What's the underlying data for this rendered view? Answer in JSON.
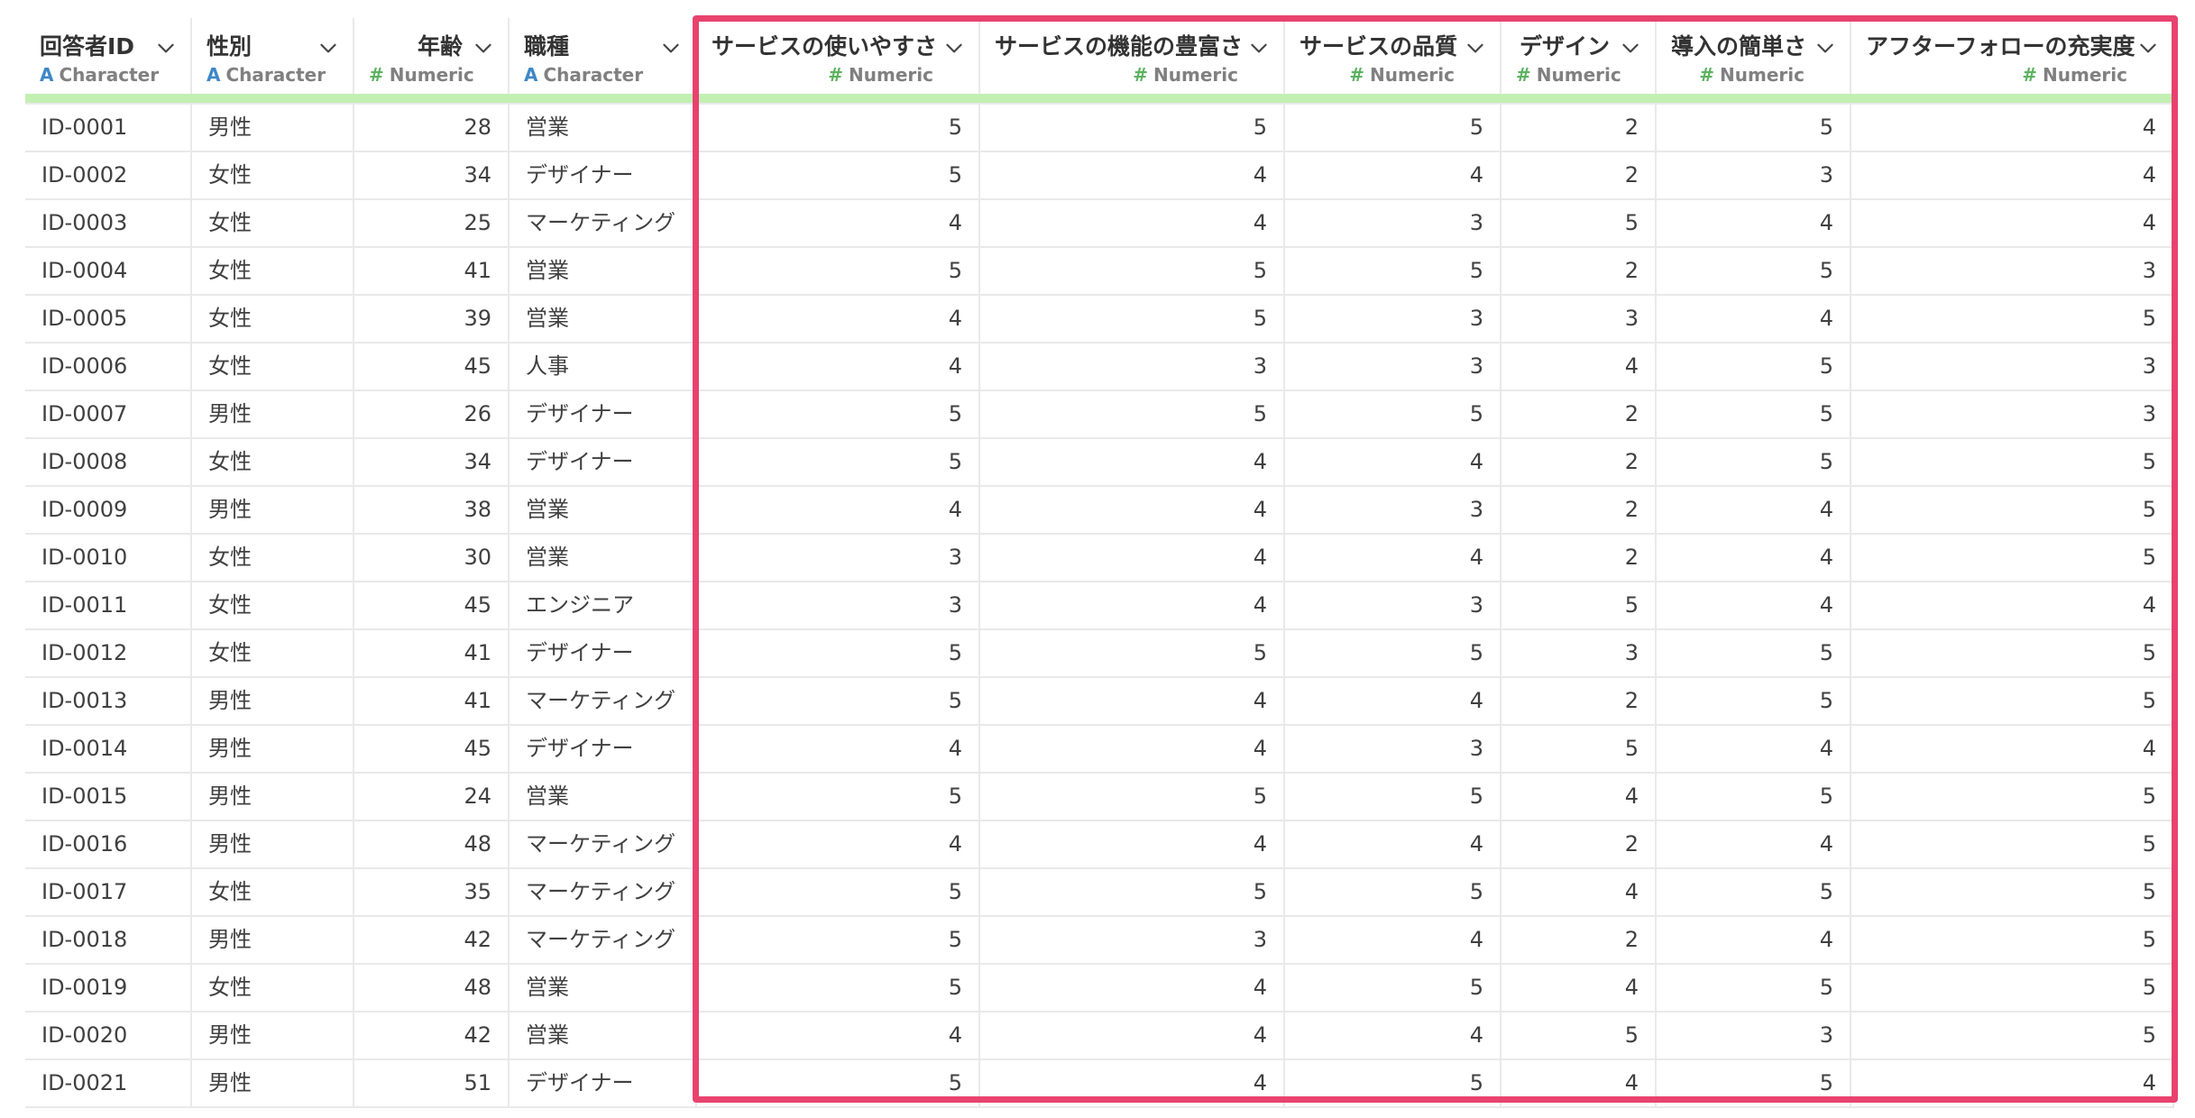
{
  "columns": [
    {
      "name": "回答者ID",
      "type": "Character",
      "kind": "chr"
    },
    {
      "name": "性別",
      "type": "Character",
      "kind": "chr"
    },
    {
      "name": "年齢",
      "type": "Numeric",
      "kind": "num"
    },
    {
      "name": "職種",
      "type": "Character",
      "kind": "chr"
    },
    {
      "name": "サービスの使いやすさ",
      "type": "Numeric",
      "kind": "num"
    },
    {
      "name": "サービスの機能の豊富さ",
      "type": "Numeric",
      "kind": "num"
    },
    {
      "name": "サービスの品質",
      "type": "Numeric",
      "kind": "num"
    },
    {
      "name": "デザイン",
      "type": "Numeric",
      "kind": "num"
    },
    {
      "name": "導入の簡単さ",
      "type": "Numeric",
      "kind": "num"
    },
    {
      "name": "アフターフォローの充実度",
      "type": "Numeric",
      "kind": "num"
    }
  ],
  "type_icons": {
    "Character": "A",
    "Numeric": "#"
  },
  "colors": {
    "highlight": "#e8426e",
    "header_bar": "#c2f0b3",
    "character_icon": "#3f87c7",
    "numeric_icon": "#5cb25f"
  },
  "rows": [
    [
      "ID-0001",
      "男性",
      "28",
      "営業",
      "5",
      "5",
      "5",
      "2",
      "5",
      "4"
    ],
    [
      "ID-0002",
      "女性",
      "34",
      "デザイナー",
      "5",
      "4",
      "4",
      "2",
      "3",
      "4"
    ],
    [
      "ID-0003",
      "女性",
      "25",
      "マーケティング",
      "4",
      "4",
      "3",
      "5",
      "4",
      "4"
    ],
    [
      "ID-0004",
      "女性",
      "41",
      "営業",
      "5",
      "5",
      "5",
      "2",
      "5",
      "3"
    ],
    [
      "ID-0005",
      "女性",
      "39",
      "営業",
      "4",
      "5",
      "3",
      "3",
      "4",
      "5"
    ],
    [
      "ID-0006",
      "女性",
      "45",
      "人事",
      "4",
      "3",
      "3",
      "4",
      "5",
      "3"
    ],
    [
      "ID-0007",
      "男性",
      "26",
      "デザイナー",
      "5",
      "5",
      "5",
      "2",
      "5",
      "3"
    ],
    [
      "ID-0008",
      "女性",
      "34",
      "デザイナー",
      "5",
      "4",
      "4",
      "2",
      "5",
      "5"
    ],
    [
      "ID-0009",
      "男性",
      "38",
      "営業",
      "4",
      "4",
      "3",
      "2",
      "4",
      "5"
    ],
    [
      "ID-0010",
      "女性",
      "30",
      "営業",
      "3",
      "4",
      "4",
      "2",
      "4",
      "5"
    ],
    [
      "ID-0011",
      "女性",
      "45",
      "エンジニア",
      "3",
      "4",
      "3",
      "5",
      "4",
      "4"
    ],
    [
      "ID-0012",
      "女性",
      "41",
      "デザイナー",
      "5",
      "5",
      "5",
      "3",
      "5",
      "5"
    ],
    [
      "ID-0013",
      "男性",
      "41",
      "マーケティング",
      "5",
      "4",
      "4",
      "2",
      "5",
      "5"
    ],
    [
      "ID-0014",
      "男性",
      "45",
      "デザイナー",
      "4",
      "4",
      "3",
      "5",
      "4",
      "4"
    ],
    [
      "ID-0015",
      "男性",
      "24",
      "営業",
      "5",
      "5",
      "5",
      "4",
      "5",
      "5"
    ],
    [
      "ID-0016",
      "男性",
      "48",
      "マーケティング",
      "4",
      "4",
      "4",
      "2",
      "4",
      "5"
    ],
    [
      "ID-0017",
      "女性",
      "35",
      "マーケティング",
      "5",
      "5",
      "5",
      "4",
      "5",
      "5"
    ],
    [
      "ID-0018",
      "男性",
      "42",
      "マーケティング",
      "5",
      "3",
      "4",
      "2",
      "4",
      "5"
    ],
    [
      "ID-0019",
      "女性",
      "48",
      "営業",
      "5",
      "4",
      "5",
      "4",
      "5",
      "5"
    ],
    [
      "ID-0020",
      "男性",
      "42",
      "営業",
      "4",
      "4",
      "4",
      "5",
      "3",
      "5"
    ],
    [
      "ID-0021",
      "男性",
      "51",
      "デザイナー",
      "5",
      "4",
      "5",
      "4",
      "5",
      "4"
    ]
  ]
}
